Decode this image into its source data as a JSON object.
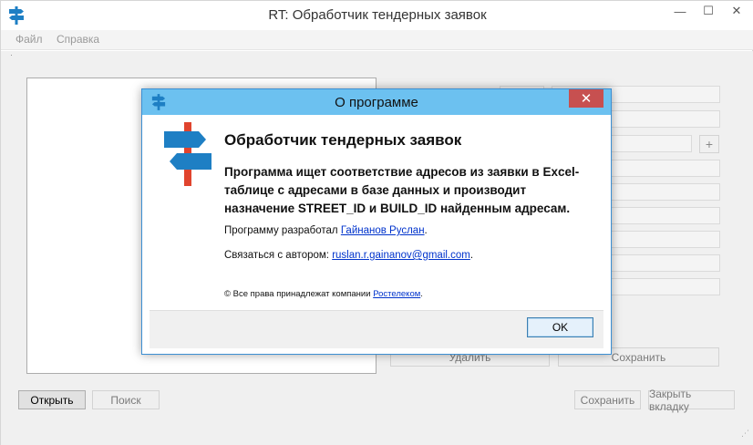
{
  "window": {
    "title": "RT: Обработчик тендерных заявок",
    "minimize_glyph": "—",
    "maximize_glyph": "☐",
    "close_glyph": "✕",
    "icon": "signpost-icon"
  },
  "menu": {
    "items": [
      {
        "label": "Файл"
      },
      {
        "label": "Справка"
      }
    ]
  },
  "main": {
    "mini_buttons": [
      {
        "label": "+"
      }
    ],
    "action_buttons": {
      "delete": "Удалить",
      "save": "Сохранить"
    },
    "bottom_buttons": {
      "open": "Открыть",
      "search": "Поиск",
      "save": "Сохранить",
      "close_tab": "Закрыть вкладку"
    }
  },
  "dialog": {
    "title": "О программе",
    "close_glyph": "✕",
    "heading": "Обработчик тендерных заявок",
    "description": "Программа ищет соответствие адресов из заявки в Excel-таблице с адресами в базе данных и производит назначение STREET_ID и BUILD_ID найденным адресам.",
    "developer_prefix": "Программу разработал",
    "developer_name": "Гайнанов Руслан",
    "developer_suffix": ".",
    "contact_prefix": "Связаться с автором:",
    "contact_email": "ruslan.r.gainanov@gmail.com",
    "contact_suffix": ".",
    "copyright_prefix": "© Все права принадлежат компании",
    "copyright_company": "Ростелеком",
    "copyright_suffix": ".",
    "ok_label": "OK"
  },
  "colors": {
    "dialog_titlebar": "#6cc1f0",
    "dialog_close": "#c75050",
    "link": "#0033cc",
    "logo_blue": "#1e7fc4",
    "logo_red": "#e0442e"
  }
}
